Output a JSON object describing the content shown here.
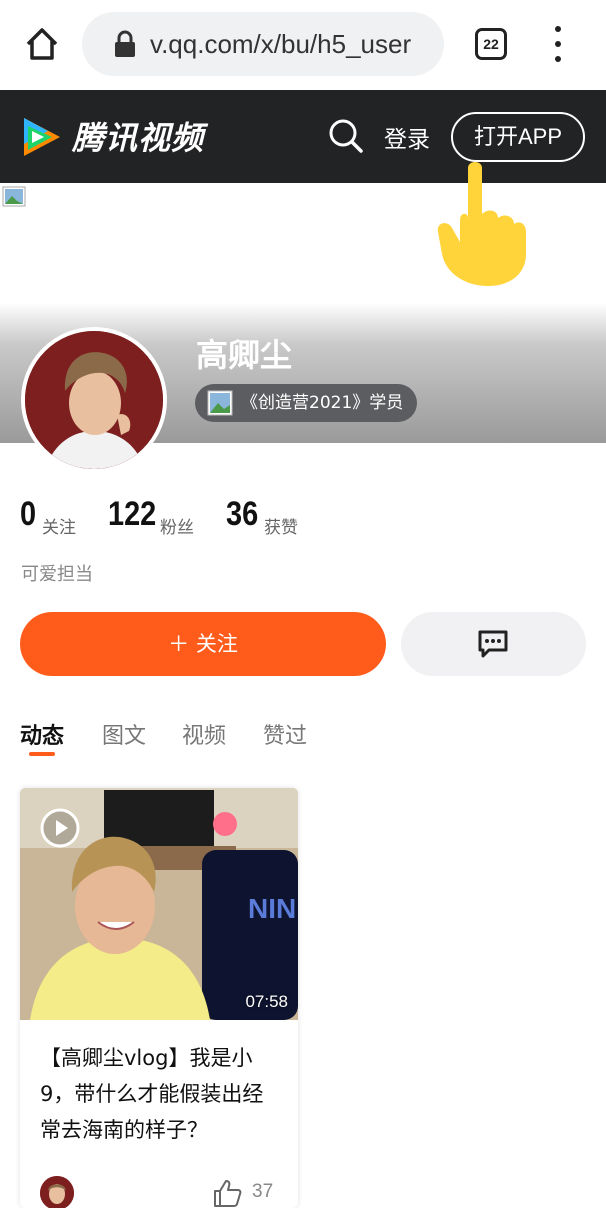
{
  "browser": {
    "url": "v.qq.com/x/bu/h5_user",
    "tab_count": "22"
  },
  "header": {
    "logo_text": "腾讯视频",
    "login_label": "登录",
    "open_app_label": "打开APP"
  },
  "profile": {
    "name": "高卿尘",
    "badge": "《创造营2021》学员",
    "bio": "可爱担当",
    "stats": [
      {
        "value": "0",
        "label": "关注"
      },
      {
        "value": "122",
        "label": "粉丝"
      },
      {
        "value": "36",
        "label": "获赞"
      }
    ],
    "follow_label": "＋ 关注"
  },
  "tabs": [
    "动态",
    "图文",
    "视频",
    "赞过"
  ],
  "active_tab": "动态",
  "feed": [
    {
      "duration": "07:58",
      "title": "【高卿尘vlog】我是小9，带什么才能假装出经常去海南的样子？",
      "likes": "37"
    }
  ],
  "colors": {
    "accent": "#ff5c1c",
    "header_bg": "#222325"
  }
}
